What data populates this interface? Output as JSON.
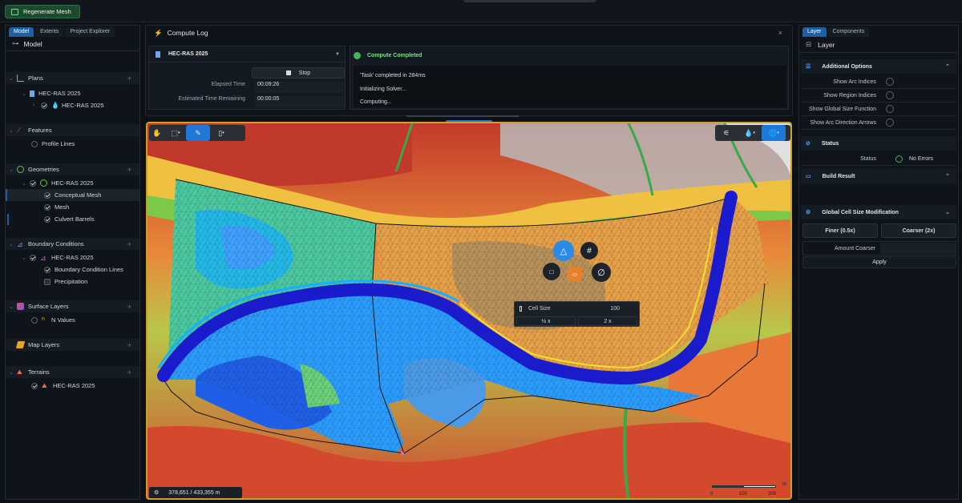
{
  "toolbar": {
    "regen_label": "Regenerate Mesh"
  },
  "left": {
    "tabs": [
      "Model",
      "Extents",
      "Project Explorer"
    ],
    "title": "Model",
    "sections": {
      "plans": {
        "label": "Plans",
        "items": [
          "HEC-RAS 2025",
          "HEC-RAS 2025"
        ]
      },
      "features": {
        "label": "Features",
        "items": [
          "Profile Lines"
        ]
      },
      "geometries": {
        "label": "Geometries",
        "items": [
          "HEC-RAS 2025",
          "Conceptual Mesh",
          "Mesh",
          "Culvert Barrels"
        ]
      },
      "boundary": {
        "label": "Boundary Conditions",
        "items": [
          "HEC-RAS 2025",
          "Boundary Condition Lines",
          "Precipitation"
        ]
      },
      "surface": {
        "label": "Surface Layers",
        "items": [
          "N Values"
        ]
      },
      "maplayers": {
        "label": "Map Layers"
      },
      "terrains": {
        "label": "Terrains",
        "items": [
          "HEC-RAS 2025"
        ]
      }
    }
  },
  "compute": {
    "title": "Compute Log",
    "plan": "HEC-RAS 2025",
    "stop_label": "Stop",
    "elapsed_label": "Elapsed Time",
    "elapsed_value": "00:09:26",
    "remaining_label": "Estimated Time Remaining",
    "remaining_value": "00:00:05",
    "status": "Compute Completed",
    "log": [
      "'Task' completed in 284ms",
      "Initializing Solver...",
      "Computing..."
    ]
  },
  "map": {
    "coords": "378,651  /  433,355 m",
    "scale_labels": [
      "0",
      "100",
      "200"
    ],
    "scale_unit": "m",
    "popup": {
      "label": "Cell Size",
      "value": "100",
      "half": "½ x",
      "double": "2 x"
    }
  },
  "right": {
    "tabs": [
      "Layer",
      "Components"
    ],
    "title": "Layer",
    "additional": {
      "label": "Additional Options",
      "options": [
        "Show Arc Indices",
        "Show Region Indices",
        "Show Global Size Function",
        "Show Arc Direction Arrows"
      ]
    },
    "status": {
      "label": "Status",
      "key": "Status",
      "value": "No Errors"
    },
    "build": {
      "label": "Build Result"
    },
    "global": {
      "label": "Global Cell Size Modification",
      "finer": "Finer (0.5x)",
      "coarser": "Coarser (2x)",
      "amount_label": "Amount Coarser",
      "apply": "Apply"
    }
  },
  "colors": {
    "accent": "#1f5fa0",
    "success": "#3fb950",
    "map_border": "#c9a227"
  }
}
